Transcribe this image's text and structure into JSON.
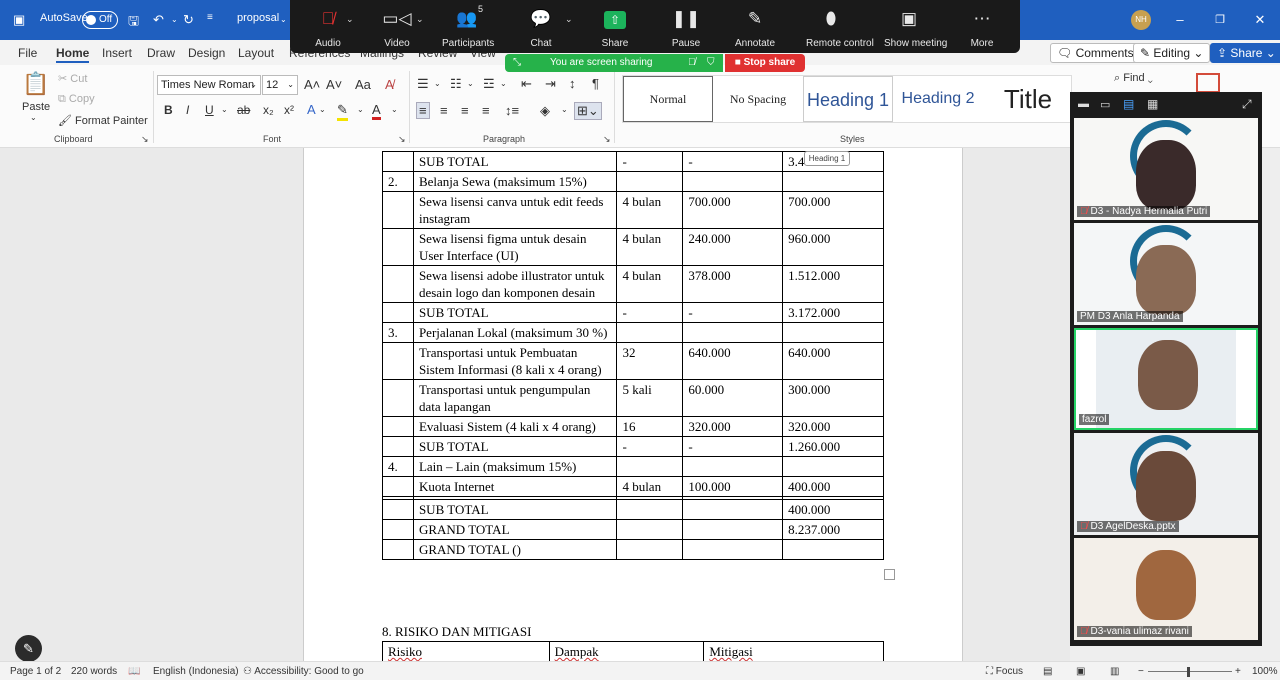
{
  "titlebar": {
    "autosave_label": "AutoSave",
    "autosave_state": "Off",
    "doc_name": "proposal",
    "user_initials": "NH",
    "colors": {
      "bar": "#1f5fbf"
    }
  },
  "zoom": {
    "buttons": [
      {
        "label": "Audio",
        "icon": "mic-off-icon"
      },
      {
        "label": "Video",
        "icon": "video-camera-icon"
      },
      {
        "label": "Participants",
        "icon": "participants-icon",
        "count": "5"
      },
      {
        "label": "Chat",
        "icon": "chat-icon"
      },
      {
        "label": "Share",
        "icon": "share-icon"
      },
      {
        "label": "Pause",
        "icon": "pause-icon"
      },
      {
        "label": "Annotate",
        "icon": "pencil-icon"
      },
      {
        "label": "Remote control",
        "icon": "mouse-icon"
      },
      {
        "label": "Show meeting",
        "icon": "show-meeting-icon"
      },
      {
        "label": "More",
        "icon": "more-icon"
      }
    ],
    "sharing_text": "You are screen sharing",
    "stop_share": "Stop share"
  },
  "menu": {
    "items": [
      "File",
      "Home",
      "Insert",
      "Draw",
      "Design",
      "Layout",
      "References",
      "Mailings",
      "Review",
      "View"
    ],
    "active": "Home",
    "comments": "Comments",
    "editing": "Editing",
    "share": "Share"
  },
  "ribbon": {
    "clipboard": {
      "paste": "Paste",
      "cut": "Cut",
      "copy": "Copy",
      "format_painter": "Format Painter",
      "group": "Clipboard"
    },
    "font": {
      "name": "Times New Roman",
      "size": "12",
      "group": "Font"
    },
    "paragraph": {
      "group": "Paragraph"
    },
    "styles": {
      "items": [
        "Normal",
        "No Spacing",
        "Heading 1",
        "Heading 2",
        "Title"
      ],
      "group": "Styles"
    },
    "find": "Find"
  },
  "document": {
    "tooltip": "Heading 1",
    "rows": [
      {
        "no": "",
        "item": "SUB TOTAL",
        "qty": "-",
        "price": "-",
        "total": "3.4"
      },
      {
        "no": "2.",
        "item": "Belanja Sewa (maksimum 15%)",
        "qty": "",
        "price": "",
        "total": ""
      },
      {
        "no": "",
        "item": "Sewa lisensi canva untuk edit feeds instagram",
        "qty": "4 bulan",
        "price": "700.000",
        "total": "700.000"
      },
      {
        "no": "",
        "item": "Sewa lisensi figma untuk desain User Interface (UI)",
        "qty": "4 bulan",
        "price": "240.000",
        "total": "960.000"
      },
      {
        "no": "",
        "item": "Sewa lisensi adobe illustrator untuk desain logo dan komponen desain",
        "qty": "4 bulan",
        "price": "378.000",
        "total": "1.512.000"
      },
      {
        "no": "",
        "item": "SUB TOTAL",
        "qty": "-",
        "price": "-",
        "total": "3.172.000"
      },
      {
        "no": "3.",
        "item": "Perjalanan Lokal (maksimum 30 %)",
        "qty": "",
        "price": "",
        "total": ""
      },
      {
        "no": "",
        "item": "Transportasi untuk Pembuatan Sistem Informasi (8 kali x 4 orang)",
        "qty": "32",
        "price": "640.000",
        "total": "640.000"
      },
      {
        "no": "",
        "item": "Transportasi untuk pengumpulan data lapangan",
        "qty": "5 kali",
        "price": "60.000",
        "total": "300.000"
      },
      {
        "no": "",
        "item": "Evaluasi Sistem (4 kali x 4 orang)",
        "qty": "16",
        "price": "320.000",
        "total": "320.000"
      },
      {
        "no": "",
        "item": "SUB TOTAL",
        "qty": "-",
        "price": "-",
        "total": "1.260.000"
      },
      {
        "no": "4.",
        "item": "Lain – Lain (maksimum 15%)",
        "qty": "",
        "price": "",
        "total": ""
      },
      {
        "no": "",
        "item": "Kuota Internet",
        "qty": "4 bulan",
        "price": "100.000",
        "total": "400.000"
      },
      {
        "no": "",
        "item": "",
        "qty": "",
        "price": "",
        "total": ""
      },
      {
        "no": "",
        "item": "SUB TOTAL",
        "qty": "",
        "price": "",
        "total": "400.000"
      },
      {
        "no": "",
        "item": "GRAND TOTAL",
        "qty": "",
        "price": "",
        "total": "8.237.000"
      },
      {
        "no": "",
        "item": "GRAND TOTAL ()",
        "qty": "",
        "price": "",
        "total": ""
      }
    ],
    "section_heading": "8. RISIKO DAN MITIGASI",
    "risk_headers": [
      "Risiko",
      "Dampak",
      "Mitigasi"
    ]
  },
  "status": {
    "page": "Page 1 of 2",
    "words": "220 words",
    "language": "English (Indonesia)",
    "accessibility": "Accessibility: Good to go",
    "focus": "Focus",
    "zoom_level": "100%"
  },
  "participants": [
    {
      "name": "D3 - Nadya Hermalia Putri",
      "muted": true
    },
    {
      "name": "PM D3 Anla Harpanda",
      "muted": false
    },
    {
      "name": "fazrol",
      "muted": false,
      "active": true
    },
    {
      "name": "D3 AgelDeska.pptx",
      "muted": true
    },
    {
      "name": "D3-vania ulimaz rivani",
      "muted": true
    }
  ]
}
